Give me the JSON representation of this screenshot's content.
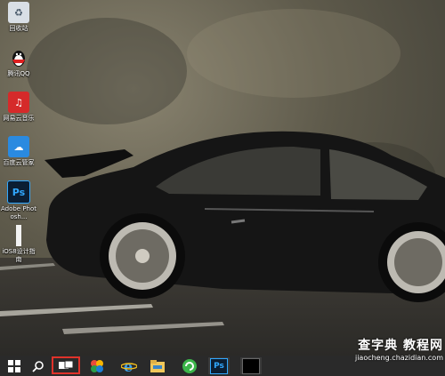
{
  "desktop_icons": [
    {
      "label": "回收站",
      "icon": "recycle-bin-icon"
    },
    {
      "label": "腾讯QQ",
      "icon": "qq-penguin-icon"
    },
    {
      "label": "网易云音乐",
      "icon": "netease-music-icon"
    },
    {
      "label": "百度云管家",
      "icon": "baidu-cloud-icon"
    },
    {
      "label": "Adobe Photosh...",
      "icon": "photoshop-icon"
    },
    {
      "label": "iOS8设计指南",
      "icon": "document-icon"
    }
  ],
  "taskbar": {
    "items": [
      "start-icon",
      "search-icon",
      "task-view-icon",
      "colorful-app-icon",
      "internet-explorer-icon",
      "file-explorer-icon",
      "green-refresh-icon",
      "photoshop-icon",
      "dark-app-icon"
    ]
  },
  "watermark": {
    "title": "查字典 教程网",
    "url": "jiaocheng.chazidian.com"
  },
  "colors": {
    "taskbar_bg": "#2a2a2a",
    "highlight_border": "#e0322a",
    "ps_blue": "#31a8ff"
  }
}
